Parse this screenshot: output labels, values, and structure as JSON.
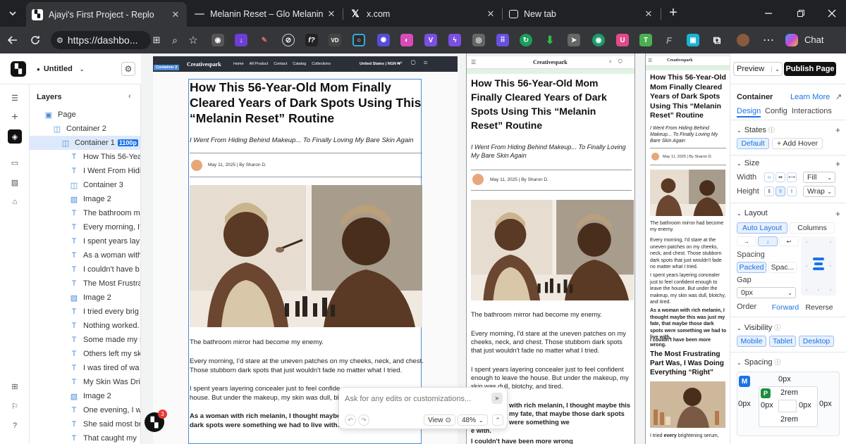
{
  "browser": {
    "tabs": [
      {
        "title": "Ajayi's First Project - Replo",
        "active": true
      },
      {
        "title": "Melanin Reset – Glo Melanin",
        "active": false
      },
      {
        "title": "x.com",
        "active": false
      },
      {
        "title": "New tab",
        "active": false
      }
    ],
    "new_tab": "+",
    "url": "https://dashbo...",
    "chat_label": "Chat"
  },
  "app": {
    "project_name": "Untitled",
    "layers_title": "Layers",
    "layers": [
      {
        "label": "Page",
        "icon": "page",
        "depth": 0
      },
      {
        "label": "Container 2",
        "icon": "container",
        "depth": 1
      },
      {
        "label": "Container 1",
        "icon": "container",
        "depth": 2,
        "badge": "1100p",
        "selected": true
      },
      {
        "label": "How This 56-Yea",
        "icon": "text",
        "depth": 3
      },
      {
        "label": "I Went From Hidi",
        "icon": "text",
        "depth": 3
      },
      {
        "label": "Container 3",
        "icon": "container",
        "depth": 3
      },
      {
        "label": "Image 2",
        "icon": "image",
        "depth": 3
      },
      {
        "label": "The bathroom m",
        "icon": "text",
        "depth": 3
      },
      {
        "label": "Every morning, I'",
        "icon": "text",
        "depth": 3
      },
      {
        "label": "I spent years lay",
        "icon": "text",
        "depth": 3
      },
      {
        "label": "As a woman with",
        "icon": "text",
        "depth": 3
      },
      {
        "label": "I couldn't have b",
        "icon": "text",
        "depth": 3
      },
      {
        "label": "The Most Frustra",
        "icon": "text",
        "depth": 3
      },
      {
        "label": "Image 2",
        "icon": "image",
        "depth": 3
      },
      {
        "label": "I tried every brig",
        "icon": "text",
        "depth": 3
      },
      {
        "label": "Nothing worked.",
        "icon": "text",
        "depth": 3
      },
      {
        "label": "Some made my s",
        "icon": "text",
        "depth": 3
      },
      {
        "label": "Others left my sk",
        "icon": "text",
        "depth": 3
      },
      {
        "label": "I was tired of wa",
        "icon": "text",
        "depth": 3
      },
      {
        "label": "My Skin Was Dri",
        "icon": "text",
        "depth": 3
      },
      {
        "label": "Image 2",
        "icon": "image",
        "depth": 3
      },
      {
        "label": "One evening, I w",
        "icon": "text",
        "depth": 3
      },
      {
        "label": "She said most br",
        "icon": "text",
        "depth": 3
      },
      {
        "label": "That caught my",
        "icon": "text",
        "depth": 3
      }
    ],
    "notification_count": "3",
    "toolbar": {
      "preview": "Preview",
      "publish": "Publish Page"
    }
  },
  "canvas": {
    "container_tag": "Container 2",
    "site": {
      "brand": "Creativespark",
      "nav_links": [
        "Home",
        "All Product",
        "Contact",
        "Catalog",
        "Collections"
      ],
      "region": "United States | NGN ₦"
    },
    "article": {
      "title": "How This 56-Year-Old Mom Finally Cleared Years of Dark Spots Using This “Melanin Reset” Routine",
      "subtitle": "I Went From Hiding Behind Makeup... To Finally Loving My Bare Skin Again",
      "byline": "May 11, 2025 | By Sharon D.",
      "p1": "The bathroom mirror had become my enemy.",
      "p2": "Every morning, I'd stare at the uneven patches on my cheeks, neck, and chest. Those stubborn dark spots that just wouldn't fade no matter what I tried.",
      "p3": "I spent years layering concealer just to feel confident enough to leave the house. But under the makeup, my skin was dull, blotchy, and tired.",
      "p4": "As a woman with rich melanin, I thought maybe this was just my fate, that maybe those dark spots were something we had to live with.",
      "p5": "I couldn't have been more wrong.",
      "h2": "The Most Frustrating Part Was, I Was Doing Everything “Right”",
      "p6_pre": "I tried ",
      "p6_bold": "every",
      "p6_post": " brightening serum,"
    },
    "desktop_p3_cut": "I spent years layering concealer just to feel confide",
    "desktop_p3b_cut": "house. But under the makeup, my skin was dull, blo",
    "desktop_p4_cut": "As a woman with rich melanin, I thought maybe th",
    "desktop_p4b_cut": "dark spots were something we had to live with.",
    "tablet_p4_cut": "with rich melanin, I thought maybe this",
    "tablet_p4b_cut": "my fate, that maybe those dark spots were something we",
    "tablet_p4c_cut": "e with.",
    "tablet_p5_cut": "I couldn't have been more wrong"
  },
  "chat": {
    "placeholder": "Ask for any edits or customizations...",
    "view": "View",
    "zoom": "48%"
  },
  "inspector": {
    "title": "Container",
    "learn_more": "Learn More",
    "tabs": [
      "Design",
      "Config",
      "Interactions"
    ],
    "states": "States",
    "state_default": "Default",
    "add_hover": "+ Add Hover",
    "size": "Size",
    "width_label": "Width",
    "width_value": "Fill",
    "height_label": "Height",
    "height_value": "Wrap",
    "layout": "Layout",
    "auto_layout": "Auto Layout",
    "columns": "Columns",
    "spacing_label": "Spacing",
    "packed": "Packed",
    "space": "Spac...",
    "gap_label": "Gap",
    "gap_value": "0px",
    "order_label": "Order",
    "forward": "Forward",
    "reverse": "Reverse",
    "visibility": "Visibility",
    "mobile": "Mobile",
    "tablet": "Tablet",
    "desktop": "Desktop",
    "spacing_section": "Spacing",
    "margin_top": "0px",
    "margin_left": "0px",
    "margin_right": "0px",
    "padding_top": "2rem",
    "padding_left": "0px",
    "padding_right": "0px",
    "padding_bottom": "2rem",
    "m_badge": "M",
    "p_badge": "P"
  }
}
